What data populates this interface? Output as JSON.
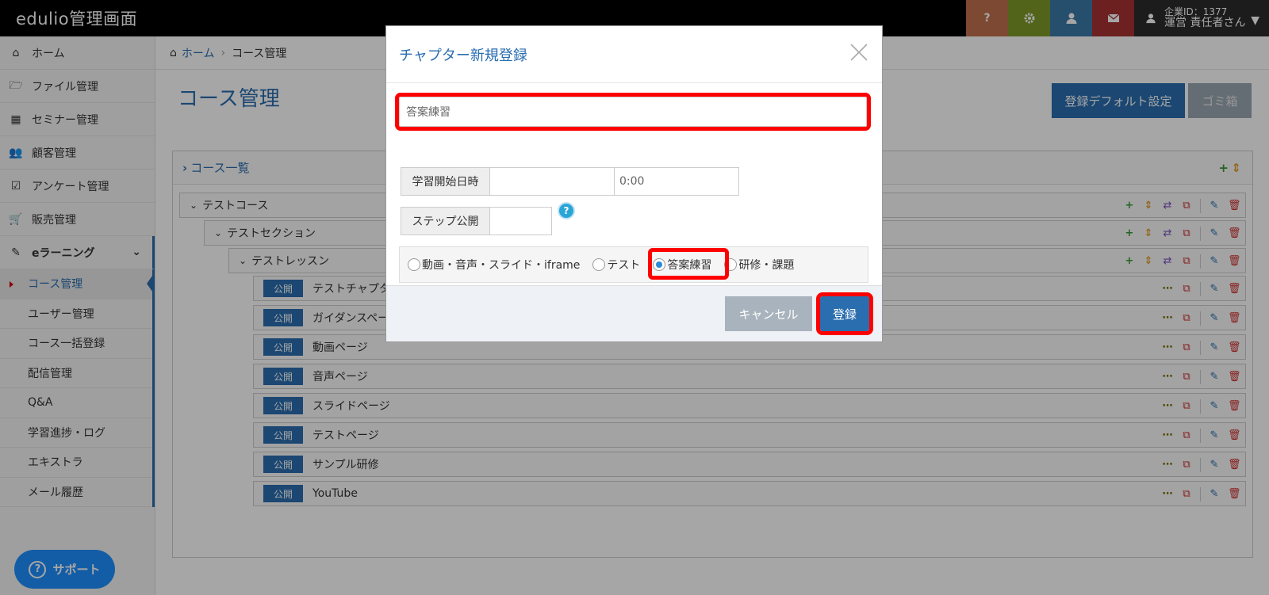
{
  "header": {
    "brand": "edulio管理画面",
    "buttons": [
      {
        "icon": "question-icon",
        "color": "#c0704e"
      },
      {
        "icon": "gear-icon",
        "color": "#7e9a28"
      },
      {
        "icon": "user-icon",
        "color": "#3b7aa8"
      },
      {
        "icon": "envelope-icon",
        "color": "#a83232"
      }
    ],
    "user": {
      "company_id": "企業ID：1377",
      "name": "運営 責任者さん"
    }
  },
  "sidebar": {
    "items": [
      {
        "label": "ホーム",
        "icon": "home-icon"
      },
      {
        "label": "ファイル管理",
        "icon": "folder-icon"
      },
      {
        "label": "セミナー管理",
        "icon": "calendar-icon"
      },
      {
        "label": "顧客管理",
        "icon": "users-icon"
      },
      {
        "label": "アンケート管理",
        "icon": "checkbox-icon"
      },
      {
        "label": "販売管理",
        "icon": "cart-icon"
      },
      {
        "label": "eラーニング",
        "icon": "pencil-icon"
      }
    ],
    "sub_items": [
      "コース管理",
      "ユーザー管理",
      "コース一括登録",
      "配信管理",
      "Q&A",
      "学習進捗・ログ",
      "エキストラ",
      "メール履歴"
    ],
    "support_label": "サポート"
  },
  "breadcrumb": {
    "home": "ホーム",
    "current": "コース管理"
  },
  "page": {
    "title": "コース管理",
    "default_setting_btn": "登録デフォルト設定",
    "trash_btn": "ゴミ箱",
    "panel_title": "コース一覧"
  },
  "tree": {
    "course": "テストコース",
    "section": "テストセクション",
    "lesson": "テストレッスン",
    "badge": "公開",
    "chapters": [
      "テストチャプター",
      "ガイダンスページ",
      "動画ページ",
      "音声ページ",
      "スライドページ",
      "テストページ",
      "サンプル研修",
      "YouTube"
    ]
  },
  "modal": {
    "title": "チャプター新規登録",
    "name_value": "答案練習",
    "start_label": "学習開始日時",
    "start_date": "",
    "start_time": "0:00",
    "step_label": "ステップ公開",
    "step_value": "",
    "types": [
      "動画・音声・スライド・iframe",
      "テスト",
      "答案練習",
      "研修・課題"
    ],
    "selected_type": "答案練習",
    "cancel": "キャンセル",
    "save": "登録"
  }
}
